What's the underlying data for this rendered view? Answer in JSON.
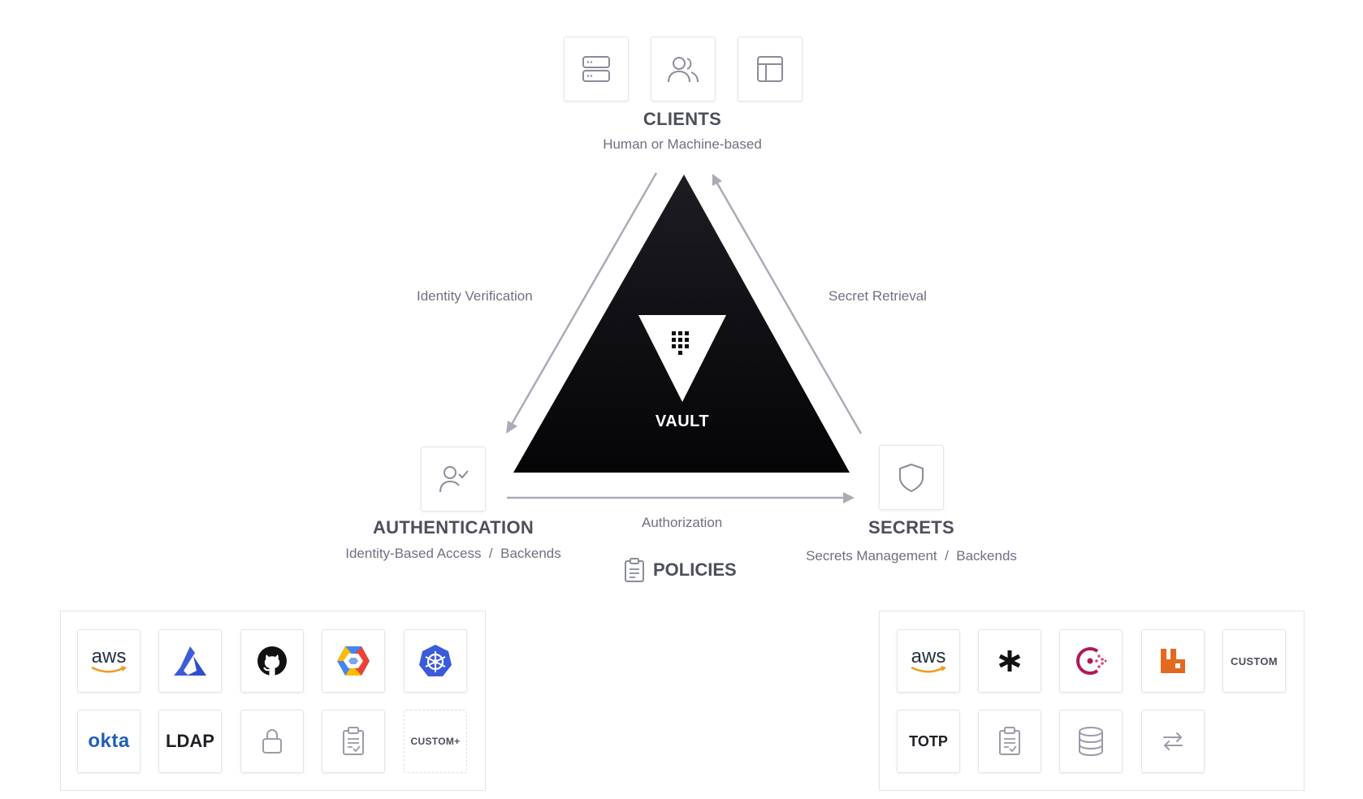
{
  "clients": {
    "title": "CLIENTS",
    "subtitle": "Human or Machine-based",
    "icons": [
      "server-icon",
      "users-icon",
      "layout-icon"
    ]
  },
  "vault": {
    "label": "VAULT",
    "logo": "vault-logo-icon"
  },
  "edges": {
    "identity_verification": "Identity Verification",
    "secret_retrieval": "Secret Retrieval",
    "authorization": "Authorization"
  },
  "authentication": {
    "title": "AUTHENTICATION",
    "subtitle": "Identity-Based Access  /  Backends",
    "icon": "user-check-icon"
  },
  "secrets": {
    "title": "SECRETS",
    "subtitle": "Secrets Management  /  Backends",
    "icon": "shield-icon"
  },
  "policies": {
    "title": "POLICIES",
    "icon": "clipboard-icon"
  },
  "auth_backends": {
    "aws_text": "aws",
    "okta_text": "okta",
    "ldap_text": "LDAP",
    "custom_text": "CUSTOM+"
  },
  "secret_backends": {
    "aws_text": "aws",
    "custom_text": "CUSTOM",
    "totp_text": "TOTP"
  },
  "colors": {
    "triangle": "#0b0b0f",
    "arrow": "#a9abb8",
    "tile_border": "#e4e5e9",
    "azure": "#3b5bd9",
    "kubernetes": "#3b5bd9",
    "okta": "#1f5fb8",
    "consul": "#b0195b",
    "rabbitmq": "#e26a20",
    "aws_orange": "#f29b1d"
  }
}
